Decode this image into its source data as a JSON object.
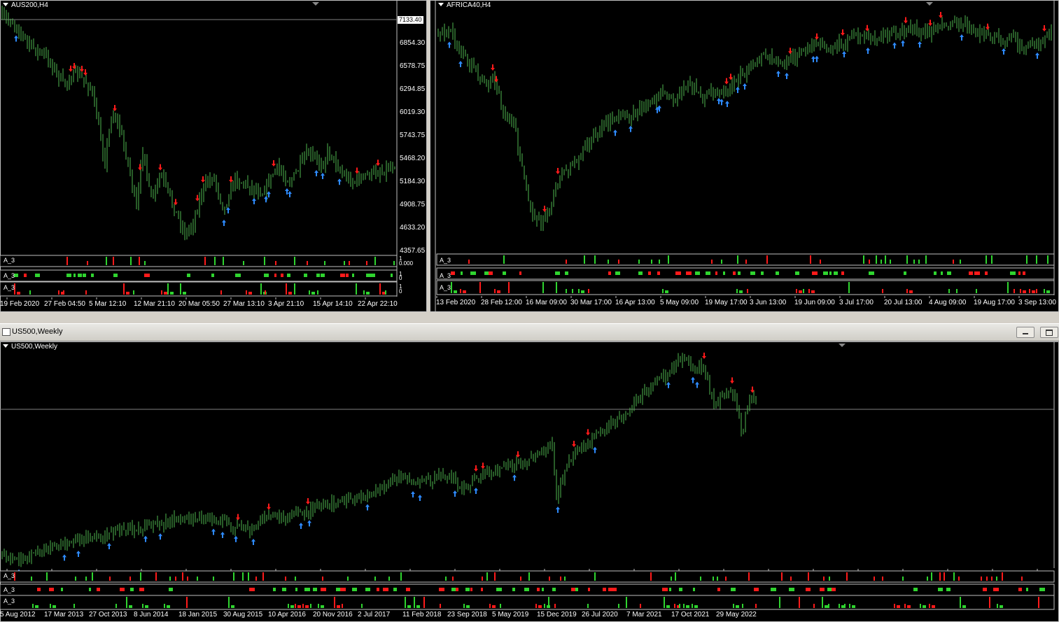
{
  "window_colors": {
    "bull": "#2fd42f",
    "bear": "#ff1a1a",
    "arrow_up": "#2e8bff",
    "arrow_down": "#ff1a1a",
    "candle": "#4fb84f",
    "grid_line": "#808080"
  },
  "charts": {
    "aus": {
      "title": "AUS200,H4",
      "price_labels": [
        "7133.40",
        "6854.30",
        "6578.75",
        "6294.85",
        "6019.30",
        "5743.75",
        "5468.20",
        "5184.30",
        "4908.75",
        "4633.20",
        "4357.65"
      ],
      "indicator_labels": [
        "A_3",
        "A_3",
        "A_3"
      ],
      "indicator_scale": [
        "1",
        "0.000",
        "1",
        "0",
        "1",
        "0"
      ],
      "dates": [
        "19 Feb 2020",
        "27 Feb 04:50",
        "5 Mar 12:10",
        "12 Mar 21:10",
        "20 Mar 05:50",
        "27 Mar 13:10",
        "3 Apr 21:10",
        "15 Apr 14:10",
        "22 Apr 22:10"
      ]
    },
    "africa": {
      "title": "AFRICA40,H4",
      "indicator_labels": [
        "A_3",
        "A_3",
        "A_3"
      ],
      "dates": [
        "13 Feb 2020",
        "28 Feb 12:00",
        "16 Mar 09:00",
        "30 Mar 17:00",
        "16 Apr 13:00",
        "5 May 09:00",
        "19 May 17:00",
        "3 Jun 13:00",
        "19 Jun 09:00",
        "3 Jul 17:00",
        "20 Jul 13:00",
        "4 Aug 09:00",
        "19 Aug 17:00",
        "3 Sep 13:00"
      ]
    },
    "us": {
      "window_title": "US500,Weekly",
      "title": "US500,Weekly",
      "indicator_labels": [
        "A_3",
        "A_3",
        "A_3"
      ],
      "dates": [
        "5 Aug 2012",
        "17 Mar 2013",
        "27 Oct 2013",
        "8 Jun 2014",
        "18 Jan 2015",
        "30 Aug 2015",
        "10 Apr 2016",
        "20 Nov 2016",
        "2 Jul 2017",
        "11 Feb 2018",
        "23 Sep 2018",
        "5 May 2019",
        "15 Dec 2019",
        "26 Jul 2020",
        "7 Mar 2021",
        "17 Oct 2021",
        "29 May 2022"
      ]
    }
  }
}
